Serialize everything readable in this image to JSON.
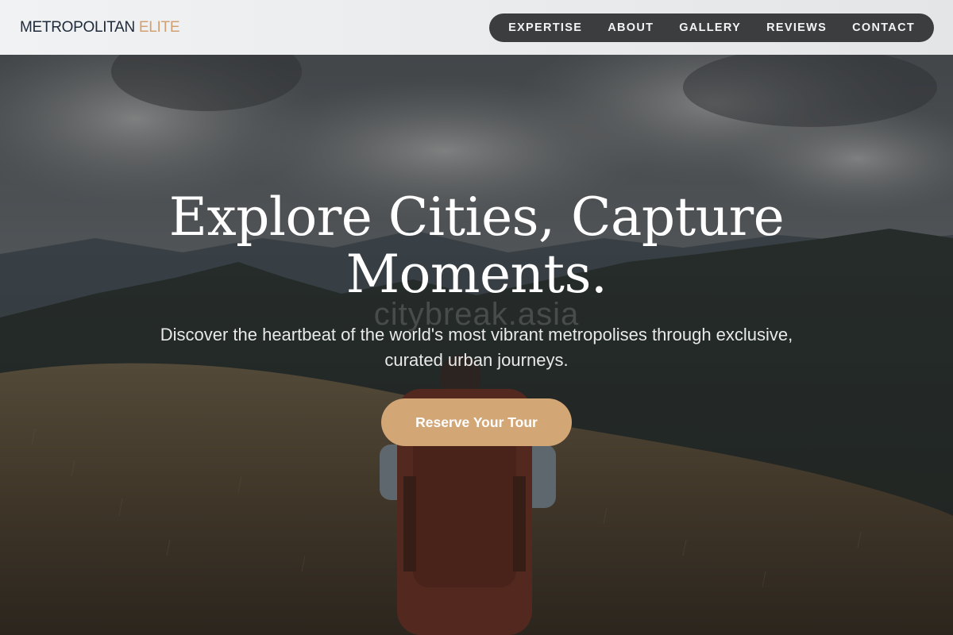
{
  "header": {
    "logo_main": "METROPOLITAN",
    "logo_accent": "ELITE",
    "nav": [
      {
        "label": "EXPERTISE"
      },
      {
        "label": "ABOUT"
      },
      {
        "label": "GALLERY"
      },
      {
        "label": "REVIEWS"
      },
      {
        "label": "CONTACT"
      }
    ]
  },
  "hero": {
    "title_line1": "Explore Cities, Capture",
    "title_line2": "Moments.",
    "subtitle": "Discover the heartbeat of the world's most vibrant metropolises through exclusive, curated urban journeys.",
    "watermark": "citybreak.asia",
    "cta_label": "Reserve Your Tour",
    "background_image": "hiker-with-backpack-on-grassy-mountain-ridge"
  },
  "colors": {
    "accent": "#d3a676",
    "logo_text": "#1f2a3a",
    "logo_accent": "#d3a072",
    "nav_pill": "#3b3d3f"
  }
}
